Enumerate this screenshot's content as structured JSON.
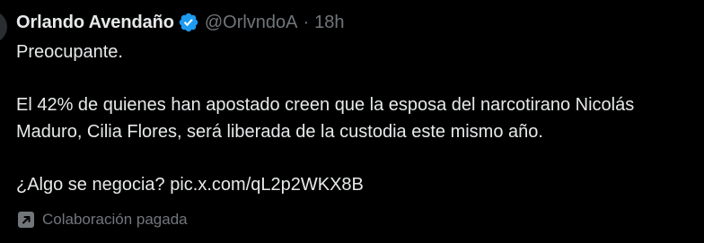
{
  "tweet": {
    "author_name": "Orlando Avendaño",
    "handle": "@OrlvndoA",
    "separator": "·",
    "time": "18h",
    "paragraph_1": "Preocupante.",
    "paragraph_2": "El 42% de quienes han apostado creen que la esposa del narcotirano Nicolás Maduro, Cilia Flores, será liberada de la custodia este mismo año.",
    "paragraph_3_text": "¿Algo se negocia? ",
    "paragraph_3_link": "pic.x.com/qL2p2WKX8B"
  },
  "footer": {
    "paid_label": "Colaboración pagada"
  },
  "icons": {
    "verified": "verified-badge-icon",
    "paid": "arrow-up-right-square-icon"
  },
  "colors": {
    "background": "#000000",
    "text": "#e7e9ea",
    "muted": "#71767b",
    "verified": "#1d9bf0"
  }
}
